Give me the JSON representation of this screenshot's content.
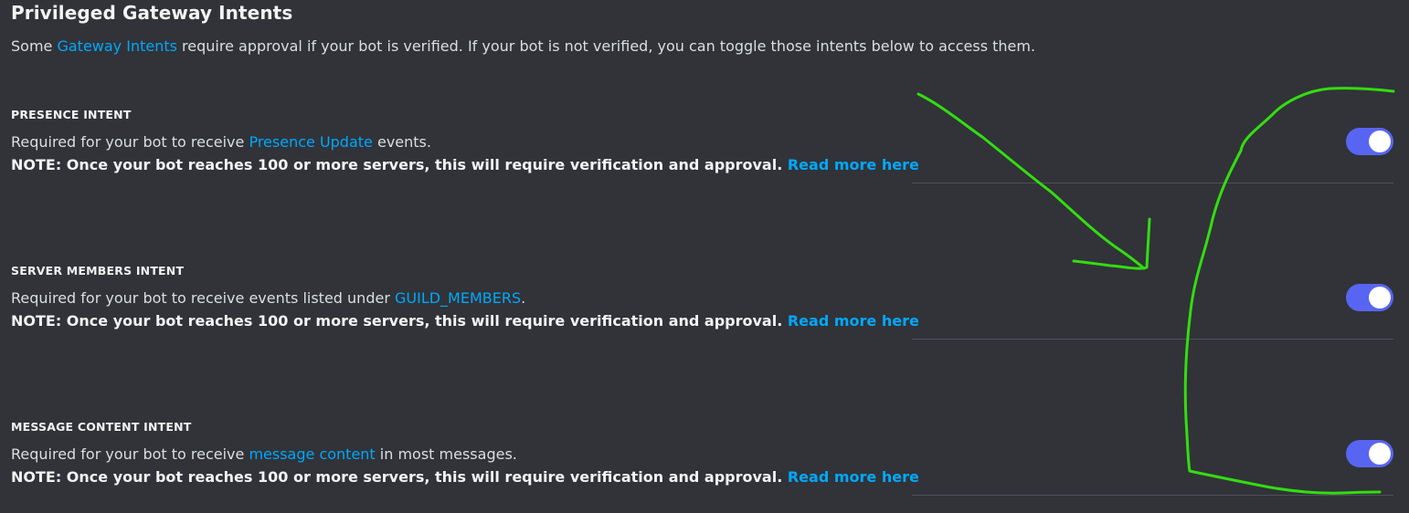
{
  "header": {
    "title": "Privileged Gateway Intents",
    "desc_prefix": "Some ",
    "desc_link": "Gateway Intents",
    "desc_suffix": " require approval if your bot is verified. If your bot is not verified, you can toggle those intents below to access them."
  },
  "intents": [
    {
      "heading": "PRESENCE INTENT",
      "line1_prefix": "Required for your bot to receive ",
      "line1_link": "Presence Update",
      "line1_suffix": " events.",
      "note": "NOTE: Once your bot reaches 100 or more servers, this will require verification and approval. ",
      "read_more": "Read more here",
      "enabled": true
    },
    {
      "heading": "SERVER MEMBERS INTENT",
      "line1_prefix": "Required for your bot to receive events listed under ",
      "line1_link": "GUILD_MEMBERS",
      "line1_suffix": ".",
      "note": "NOTE: Once your bot reaches 100 or more servers, this will require verification and approval. ",
      "read_more": "Read more here",
      "enabled": true
    },
    {
      "heading": "MESSAGE CONTENT INTENT",
      "line1_prefix": "Required for your bot to receive ",
      "line1_link": "message content",
      "line1_suffix": " in most messages.",
      "note": "NOTE: Once your bot reaches 100 or more servers, this will require verification and approval. ",
      "read_more": "Read more here",
      "enabled": true
    }
  ],
  "colors": {
    "background": "#313338",
    "link": "#00a8fc",
    "toggle_on": "#5865f2",
    "annotation": "#33dd11"
  }
}
